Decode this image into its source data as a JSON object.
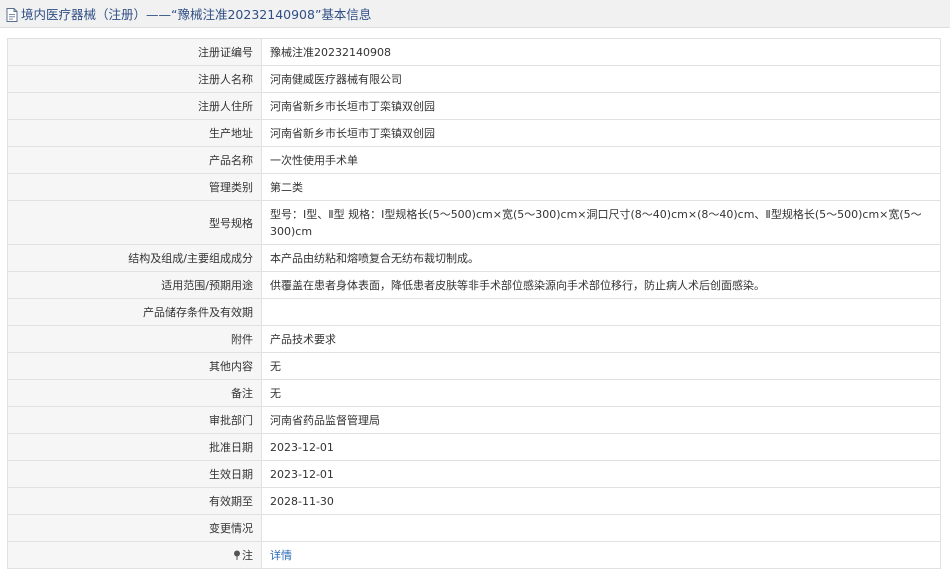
{
  "title": "境内医疗器械（注册）——“豫械注准20232140908”基本信息",
  "icons": {
    "title": "document-icon",
    "note": "pin-icon"
  },
  "rows": [
    {
      "label": "注册证编号",
      "value": "豫械注准20232140908"
    },
    {
      "label": "注册人名称",
      "value": "河南健威医疗器械有限公司"
    },
    {
      "label": "注册人住所",
      "value": "河南省新乡市长垣市丁栾镇双创园"
    },
    {
      "label": "生产地址",
      "value": "河南省新乡市长垣市丁栾镇双创园"
    },
    {
      "label": "产品名称",
      "value": "一次性使用手术单"
    },
    {
      "label": "管理类别",
      "value": "第二类"
    },
    {
      "label": "型号规格",
      "value": "型号：Ⅰ型、Ⅱ型 规格：Ⅰ型规格长(5～500)cm×宽(5～300)cm×洞口尺寸(8～40)cm×(8～40)cm、Ⅱ型规格长(5～500)cm×宽(5～300)cm"
    },
    {
      "label": "结构及组成/主要组成成分",
      "value": "本产品由纺粘和熔喷复合无纺布裁切制成。"
    },
    {
      "label": "适用范围/预期用途",
      "value": "供覆盖在患者身体表面，降低患者皮肤等非手术部位感染源向手术部位移行，防止病人术后创面感染。"
    },
    {
      "label": "产品储存条件及有效期",
      "value": ""
    },
    {
      "label": "附件",
      "value": "产品技术要求"
    },
    {
      "label": "其他内容",
      "value": "无"
    },
    {
      "label": "备注",
      "value": "无"
    },
    {
      "label": "审批部门",
      "value": "河南省药品监督管理局"
    },
    {
      "label": "批准日期",
      "value": "2023-12-01"
    },
    {
      "label": "生效日期",
      "value": "2023-12-01"
    },
    {
      "label": "有效期至",
      "value": "2028-11-30"
    },
    {
      "label": "变更情况",
      "value": ""
    },
    {
      "label": "注",
      "value": "详情"
    }
  ]
}
